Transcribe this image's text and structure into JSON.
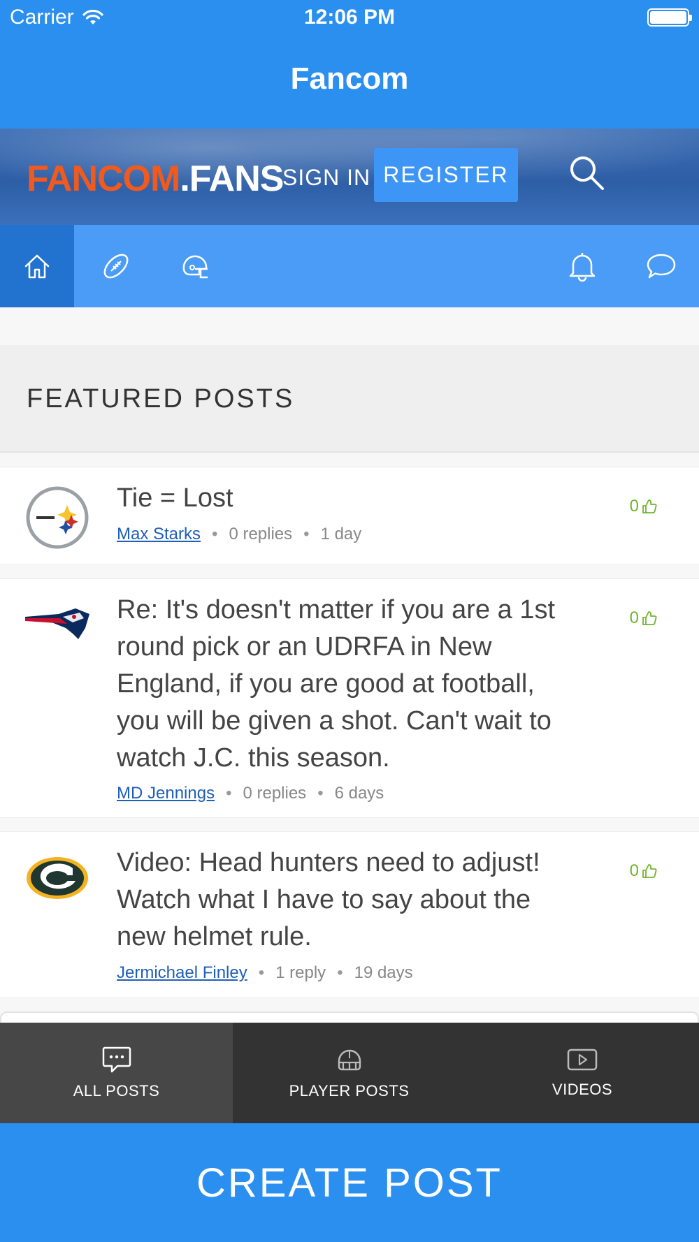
{
  "status_bar": {
    "carrier": "Carrier",
    "time": "12:06 PM"
  },
  "nav": {
    "title": "Fancom"
  },
  "banner": {
    "logo_part1": "FANCOM",
    "logo_part2": ".FANS",
    "sign_in": "SIGN IN",
    "register": "REGISTER"
  },
  "icon_nav": [
    "home-icon",
    "football-icon",
    "helmet-icon",
    "bell-icon",
    "chat-bubble-icon"
  ],
  "featured": {
    "heading": "FEATURED POSTS"
  },
  "posts": [
    {
      "team": "Steelers",
      "title": "Tie = Lost",
      "author": "Max Starks",
      "replies": "0 replies",
      "age": "1 day",
      "likes": "0"
    },
    {
      "team": "Patriots",
      "title": "Re: It's doesn't matter if you are a 1st round pick or an UDRFA in New England, if you are good at football, you will be given a shot. Can't wait to watch J.C. this season.",
      "author": "MD Jennings",
      "replies": "0 replies",
      "age": "6 days",
      "likes": "0"
    },
    {
      "team": "Packers",
      "title": "Video: Head hunters need to adjust! Watch what I have to say about the new helmet rule.",
      "author": "Jermichael Finley",
      "replies": "1 reply",
      "age": "19 days",
      "likes": "0"
    }
  ],
  "tabs": [
    {
      "label": "ALL POSTS",
      "icon": "chat-icon"
    },
    {
      "label": "PLAYER POSTS",
      "icon": "helmet-icon"
    },
    {
      "label": "VIDEOS",
      "icon": "play-icon"
    }
  ],
  "create_post": "CREATE POST",
  "colors": {
    "primary": "#2b8ff0",
    "nav_active": "#2273d0",
    "like_green": "#6fb52c",
    "link_blue": "#1f5fb7",
    "tabbar": "#333333",
    "logo_orange": "#f05a1e"
  }
}
